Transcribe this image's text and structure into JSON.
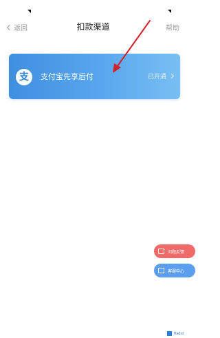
{
  "nav": {
    "back_label": "返回",
    "title": "扣款渠道",
    "help_label": "帮助"
  },
  "channel_card": {
    "icon_glyph": "支",
    "icon": "alipay-icon",
    "label": "支付宝先享后付",
    "status": "已开通"
  },
  "floating_buttons": {
    "red_label": "问题反馈",
    "blue_label": "客服中心"
  },
  "watermark": {
    "text": "Hadid"
  },
  "colors": {
    "card_start": "#3f8fe0",
    "card_end": "#79bff4",
    "annotation_arrow": "#d0212b",
    "float_red": "#f06a6a",
    "float_blue": "#5b9ef0"
  }
}
